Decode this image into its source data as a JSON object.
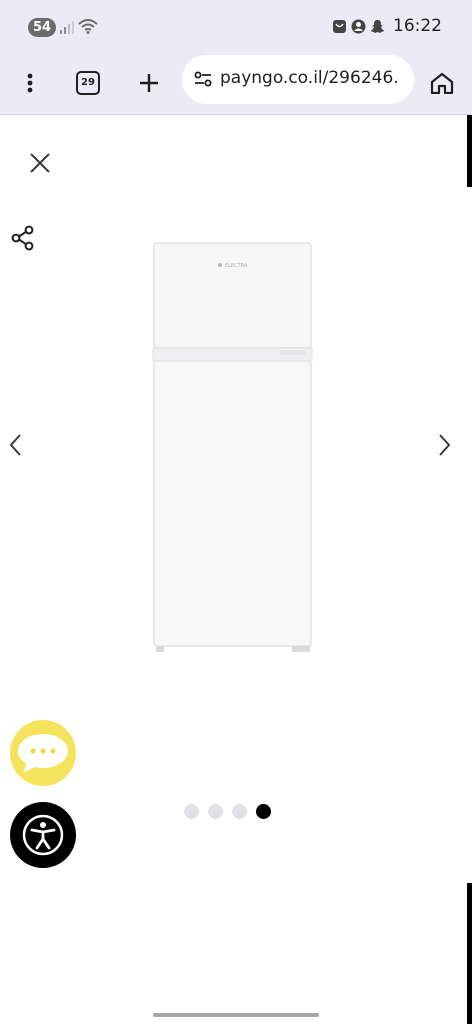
{
  "status_bar": {
    "notification_count": "54",
    "time": "16:22",
    "icons": [
      "signal-icon",
      "wifi-icon",
      "screen-record-icon",
      "account-icon",
      "snapchat-icon"
    ]
  },
  "browser": {
    "tab_count": "29",
    "url": "payngo.co.il/296246.",
    "icons": [
      "menu-dots-icon",
      "new-tab-icon",
      "site-settings-icon",
      "home-icon"
    ]
  },
  "gallery": {
    "slide_count": 4,
    "active_slide": 4,
    "image": "refrigerator-white-two-door",
    "fridge_brand_text": "ELECTRA"
  },
  "colors": {
    "chrome_bg": "#eceaf3",
    "chat_button": "#f4e45d",
    "accessibility_button": "#000000",
    "dot_inactive": "#e2e2e6",
    "dot_active": "#000000"
  }
}
